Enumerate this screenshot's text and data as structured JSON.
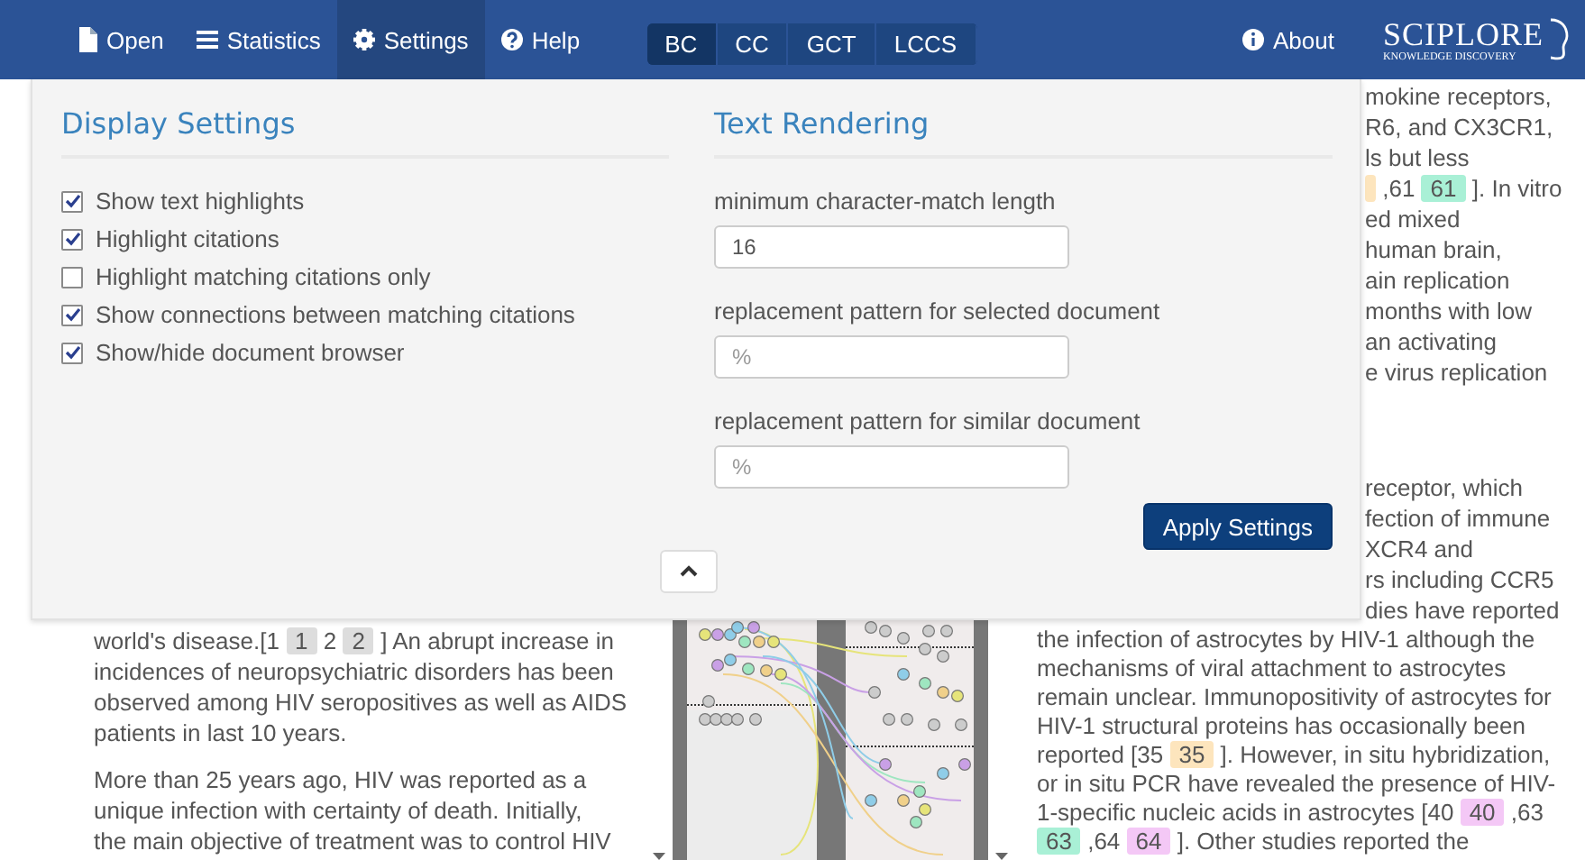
{
  "navbar": {
    "items": [
      {
        "label": "Open",
        "selected": false
      },
      {
        "label": "Statistics",
        "selected": false
      },
      {
        "label": "Settings",
        "selected": true
      },
      {
        "label": "Help",
        "selected": false
      }
    ],
    "modes": [
      {
        "label": "BC",
        "selected": true
      },
      {
        "label": "CC",
        "selected": false
      },
      {
        "label": "GCT",
        "selected": false
      },
      {
        "label": "LCCS",
        "selected": false
      }
    ],
    "about": "About",
    "logo": {
      "name": "SCIPLORE",
      "tagline": "KNOWLEDGE DISCOVERY"
    }
  },
  "settings_panel": {
    "display": {
      "title": "Display Settings",
      "options": [
        {
          "label": "Show text highlights",
          "checked": true
        },
        {
          "label": "Highlight citations",
          "checked": true
        },
        {
          "label": "Highlight matching citations only",
          "checked": false
        },
        {
          "label": "Show connections between matching citations",
          "checked": true
        },
        {
          "label": "Show/hide document browser",
          "checked": true
        }
      ]
    },
    "text_rendering": {
      "title": "Text Rendering",
      "fields": [
        {
          "label": "minimum character-match length",
          "value": "16"
        },
        {
          "label": "replacement pattern for selected document",
          "placeholder": "%"
        },
        {
          "label": "replacement pattern for similar document",
          "placeholder": "%"
        }
      ],
      "apply_button": "Apply Settings"
    }
  },
  "left_document": {
    "paragraphs": [
      {
        "kind": "lines",
        "lines": [
          [
            {
              "kind": "text",
              "text": "world's disease.[1 "
            },
            {
              "kind": "citation",
              "text": "1",
              "color": "#dddddd"
            },
            {
              "kind": "text",
              "text": " 2 "
            },
            {
              "kind": "citation",
              "text": "2",
              "color": "#dddddd"
            },
            {
              "kind": "text",
              "text": " ] An abrupt increase in"
            }
          ],
          [
            {
              "kind": "text",
              "text": "incidences of neuropsychiatric disorders has been"
            }
          ],
          [
            {
              "kind": "text",
              "text": "observed among HIV seropositives as well as AIDS"
            }
          ],
          [
            {
              "kind": "text",
              "text": "patients in last 10 years."
            }
          ]
        ]
      },
      {
        "kind": "plain",
        "text": "More than 25 years ago, HIV was reported as a unique infection with certainty of death. Initially, the main objective of treatment was to control HIV"
      }
    ]
  },
  "right_document": {
    "upper_fragments": [
      [
        {
          "kind": "text",
          "text": "mokine receptors,"
        }
      ],
      [
        {
          "kind": "text",
          "text": "R6, and CX3CR1,"
        }
      ],
      [
        {
          "kind": "text",
          "text": "ls but less"
        }
      ],
      [
        {
          "kind": "citation",
          "color": "#fde5bd"
        },
        {
          "kind": "text",
          "text": " ,61 "
        },
        {
          "kind": "citation",
          "text": "61",
          "color": "#a9f0d6"
        },
        {
          "kind": "text",
          "text": " ]. In vitro"
        }
      ],
      [
        {
          "kind": "text",
          "text": "ed mixed"
        }
      ],
      [
        {
          "kind": "text",
          "text": "human brain,"
        }
      ],
      [
        {
          "kind": "text",
          "text": "ain replication"
        }
      ],
      [
        {
          "kind": "text",
          "text": "months with low"
        }
      ],
      [
        {
          "kind": "text",
          "text": "an activating"
        }
      ],
      [
        {
          "kind": "text",
          "text": "e virus replication"
        }
      ]
    ],
    "lower_fragments": [
      [
        {
          "kind": "text",
          "text": "receptor, which"
        }
      ],
      [
        {
          "kind": "text",
          "text": "fection of immune"
        }
      ],
      [
        {
          "kind": "text",
          "text": "XCR4 and"
        }
      ],
      [
        {
          "kind": "text",
          "text": "rs including CCR5"
        }
      ],
      [
        {
          "kind": "text",
          "text": "dies have reported"
        }
      ]
    ],
    "paragraphs": [
      {
        "kind": "lines",
        "lines": [
          [
            {
              "kind": "text",
              "text": "the infection of astrocytes by HIV-1 although the"
            }
          ],
          [
            {
              "kind": "text",
              "text": "mechanisms of viral attachment to astrocytes"
            }
          ],
          [
            {
              "kind": "text",
              "text": "remain unclear. Immunopositivity of astrocytes for"
            }
          ],
          [
            {
              "kind": "text",
              "text": "HIV-1 structural proteins has occasionally been"
            }
          ],
          [
            {
              "kind": "text",
              "text": "reported [35 "
            },
            {
              "kind": "citation",
              "text": "35",
              "color": "#fde5bd"
            },
            {
              "kind": "text",
              "text": " ]. However, in situ hybridization,"
            }
          ],
          [
            {
              "kind": "text",
              "text": "or in situ PCR have revealed the presence of HIV-"
            }
          ],
          [
            {
              "kind": "text",
              "text": "1-specific nucleic acids in astrocytes [40 "
            },
            {
              "kind": "citation",
              "text": "40",
              "color": "#f4c8f6"
            },
            {
              "kind": "text",
              "text": " ,63"
            }
          ],
          [
            {
              "kind": "citation",
              "text": "63",
              "color": "#a9f0d6"
            },
            {
              "kind": "text",
              "text": " ,64 "
            },
            {
              "kind": "citation",
              "text": "64",
              "color": "#f4c8f6"
            },
            {
              "kind": "text",
              "text": " ]. Other studies reported the"
            }
          ]
        ]
      }
    ]
  }
}
